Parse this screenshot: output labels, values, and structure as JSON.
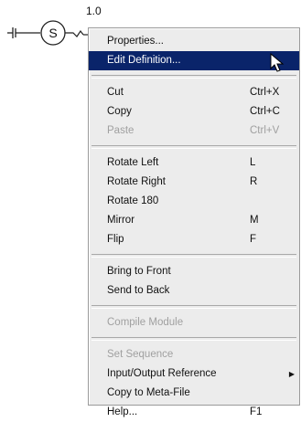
{
  "symbol": {
    "value_label": "1.0",
    "letter": "S"
  },
  "menu": {
    "sections": [
      [
        {
          "label": "Properties...",
          "shortcut": "",
          "enabled": true,
          "highlighted": false
        },
        {
          "label": "Edit Definition...",
          "shortcut": "",
          "enabled": true,
          "highlighted": true
        }
      ],
      [
        {
          "label": "Cut",
          "shortcut": "Ctrl+X",
          "enabled": true
        },
        {
          "label": "Copy",
          "shortcut": "Ctrl+C",
          "enabled": true
        },
        {
          "label": "Paste",
          "shortcut": "Ctrl+V",
          "enabled": false
        }
      ],
      [
        {
          "label": "Rotate Left",
          "shortcut": "L",
          "enabled": true
        },
        {
          "label": "Rotate Right",
          "shortcut": "R",
          "enabled": true
        },
        {
          "label": "Rotate 180",
          "shortcut": "",
          "enabled": true
        },
        {
          "label": "Mirror",
          "shortcut": "M",
          "enabled": true
        },
        {
          "label": "Flip",
          "shortcut": "F",
          "enabled": true
        }
      ],
      [
        {
          "label": "Bring to Front",
          "shortcut": "",
          "enabled": true
        },
        {
          "label": "Send to Back",
          "shortcut": "",
          "enabled": true
        }
      ],
      [
        {
          "label": "Compile Module",
          "shortcut": "",
          "enabled": false
        }
      ],
      [
        {
          "label": "Set Sequence",
          "shortcut": "",
          "enabled": false
        },
        {
          "label": "Input/Output Reference",
          "shortcut": "",
          "enabled": true,
          "submenu": true
        },
        {
          "label": "Copy to Meta-File",
          "shortcut": "",
          "enabled": true
        },
        {
          "label": "Help...",
          "shortcut": "F1",
          "enabled": true
        }
      ]
    ]
  },
  "colors": {
    "menu_bg": "#ececec",
    "highlight_bg": "#0a246a",
    "highlight_text": "#ffffff",
    "disabled_text": "#a0a0a0"
  }
}
